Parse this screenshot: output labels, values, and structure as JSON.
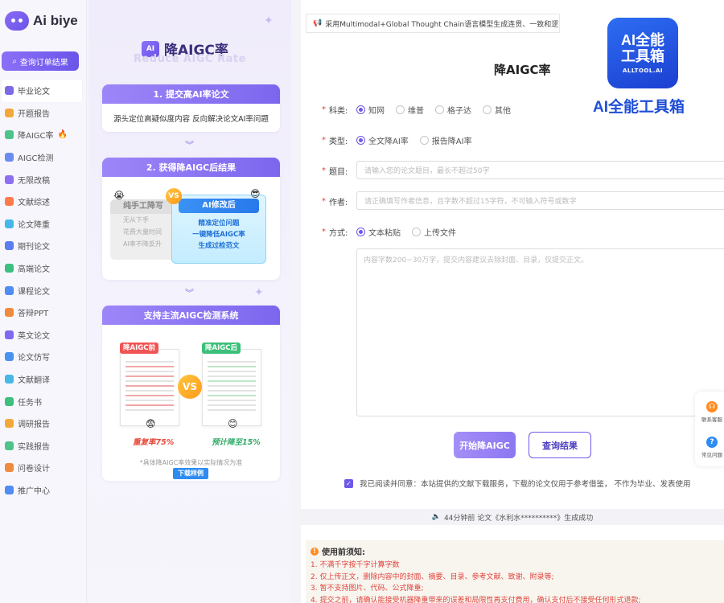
{
  "brand": {
    "name": "Ai biye"
  },
  "sidebar": {
    "query_button": "查询订单结果",
    "items": [
      {
        "label": "毕业论文",
        "color": "#7b6ae8",
        "active": true
      },
      {
        "label": "开题报告",
        "color": "#f3a93a"
      },
      {
        "label": "降AIGC率",
        "color": "#4cc48a",
        "hot": true
      },
      {
        "label": "AIGC检测",
        "color": "#6a8cf0"
      },
      {
        "label": "无限改稿",
        "color": "#8e6ff3"
      },
      {
        "label": "文献综述",
        "color": "#ff7a4a"
      },
      {
        "label": "论文降重",
        "color": "#46b8e8"
      },
      {
        "label": "期刊论文",
        "color": "#5a7ef0"
      },
      {
        "label": "高端论文",
        "color": "#3cc07d"
      },
      {
        "label": "课程论文",
        "color": "#4f8cf3"
      },
      {
        "label": "答辩PPT",
        "color": "#f08a3e"
      },
      {
        "label": "英文论文",
        "color": "#7d6af0"
      },
      {
        "label": "论文仿写",
        "color": "#4a92f0"
      },
      {
        "label": "文献翻译",
        "color": "#47b7e6"
      },
      {
        "label": "任务书",
        "color": "#3cc07d"
      },
      {
        "label": "调研报告",
        "color": "#f3a93a"
      },
      {
        "label": "实践报告",
        "color": "#4cc48a"
      },
      {
        "label": "问卷设计",
        "color": "#f08a3e"
      },
      {
        "label": "推广中心",
        "color": "#4f8cf3"
      }
    ]
  },
  "promo": {
    "badge": "AI",
    "title": "降AIGC率",
    "subtitle": "Reduce AIGC Rate",
    "card1": {
      "head": "1. 提交高AI率论文",
      "body": "源头定位高疑似度内容 反向解决论文AI率问题"
    },
    "card2": {
      "head": "2. 获得降AIGC后结果",
      "manual_title": "纯手工降写",
      "manual_lines": [
        "无从下手",
        "花费大量时间",
        "AI率不降反升"
      ],
      "vs": "VS",
      "ai_title": "AI修改后",
      "ai_lines": [
        "精准定位问题",
        "一键降低AIGC率",
        "生成过检范文"
      ]
    },
    "card3": {
      "head": "支持主流AIGC检测系统",
      "before_tag": "降AIGC前",
      "after_tag": "降AIGC后",
      "vs": "VS",
      "before_stat": "重复率75%",
      "after_stat": "预计降至15%",
      "note": "*具体降AIGC率效果以实际情况为准",
      "download": "下载样例"
    }
  },
  "main": {
    "notice": "采用Multimodal+Global Thought Chain语言模型生成连贯、一致和逻",
    "title": "降AIGC率",
    "subject": {
      "label": "科类:",
      "options": [
        "知网",
        "维普",
        "格子达",
        "其他"
      ],
      "selected": "知网"
    },
    "type": {
      "label": "类型:",
      "options": [
        "全文降AI率",
        "报告降AI率"
      ],
      "selected": "全文降AI率"
    },
    "topic": {
      "label": "题目:",
      "placeholder": "请输入您的论文题目，最长不超过50字"
    },
    "author": {
      "label": "作者:",
      "placeholder": "请正确填写作者信息，且字数不超过15字符，不可输入符号或数字"
    },
    "method": {
      "label": "方式:",
      "options": [
        "文本粘贴",
        "上传文件"
      ],
      "selected": "文本粘贴"
    },
    "content_placeholder": "内容字数200~30万字，提交内容建议去除封面、目录，仅提交正文。",
    "start_button": "开始降AIGC",
    "result_button": "查询结果",
    "agreement": "我已阅读并同意：本站提供的文献下载服务，下载的论文仅用于参考借鉴， 不作为毕业、发表使用",
    "ticker": "44分钟前 论文《水利水**********》生成成功",
    "tips_title": "使用前须知:",
    "tips": [
      "1. 不满千字按千字计算字数",
      "2. 仅上传正文，删除内容中的封面、摘要、目录、参考文献、致谢、附录等;",
      "3. 暂不支持图片、代码、公式降重;",
      "4. 提交之前，请确认能接受机器降重带来的误差和局限性再支付费用，确认支付后不接受任何形式退款;"
    ]
  },
  "watermark": {
    "line1": "AI全能",
    "line2": "工具箱",
    "domain": "ALLTOOL.AI",
    "caption": "AI全能工具箱"
  },
  "float": {
    "service": "联系客服",
    "faq": "常见问题"
  }
}
